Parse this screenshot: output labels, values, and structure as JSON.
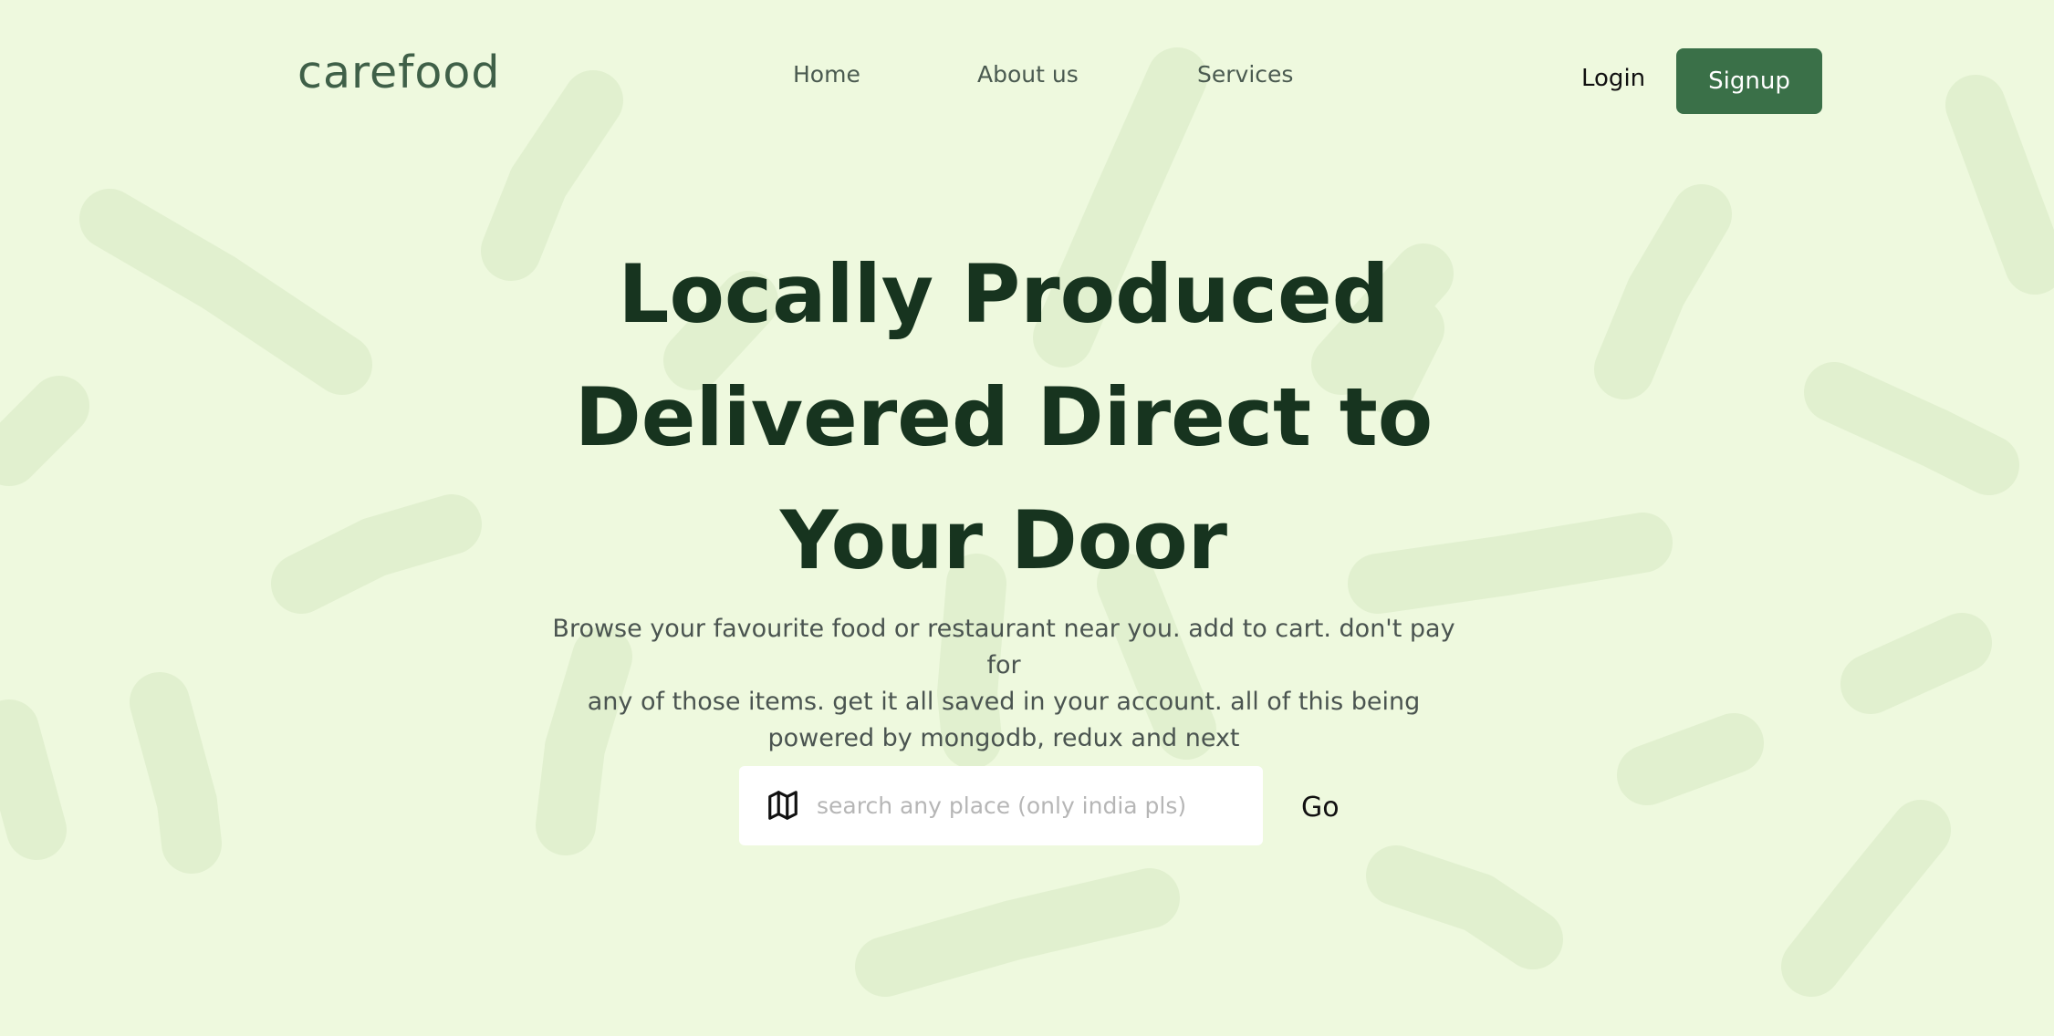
{
  "brand": {
    "logo_text": "carefood"
  },
  "nav": {
    "links": [
      {
        "label": "Home"
      },
      {
        "label": "About us"
      },
      {
        "label": "Services"
      }
    ],
    "login_label": "Login",
    "signup_label": "Signup"
  },
  "hero": {
    "title_lines": [
      "Locally Produced",
      "Delivered Direct to",
      "Your Door"
    ],
    "description_lines": [
      "Browse your favourite food or restaurant near you. add to cart. don't pay for",
      "any of those items. get it all saved in your account. all of this being",
      "powered by mongodb, redux and next"
    ]
  },
  "search": {
    "icon": "map-icon",
    "value": "",
    "placeholder": "search any place (only india pls)",
    "submit_label": "Go"
  },
  "colors": {
    "background": "#eef9de",
    "pattern": "#e1f0cf",
    "accent": "#3a7048",
    "heading": "#17341f",
    "logo": "#3f6048"
  }
}
